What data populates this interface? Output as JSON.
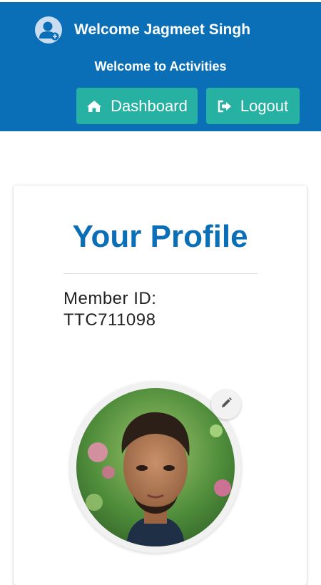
{
  "header": {
    "welcome_text": "Welcome Jagmeet Singh",
    "subtitle": "Welcome to Activities",
    "user_icon": "user-plus-icon",
    "buttons": {
      "dashboard_label": "Dashboard",
      "dashboard_icon": "home-icon",
      "logout_label": "Logout",
      "logout_icon": "sign-out-icon"
    }
  },
  "profile": {
    "title": "Your Profile",
    "member_id_label": "Member ID:",
    "member_id_value": "TTC711098",
    "edit_icon": "pencil-icon"
  },
  "colors": {
    "header_bg": "#0b6fb8",
    "button_bg": "#26b1a2",
    "title_color": "#0b6fb8"
  }
}
